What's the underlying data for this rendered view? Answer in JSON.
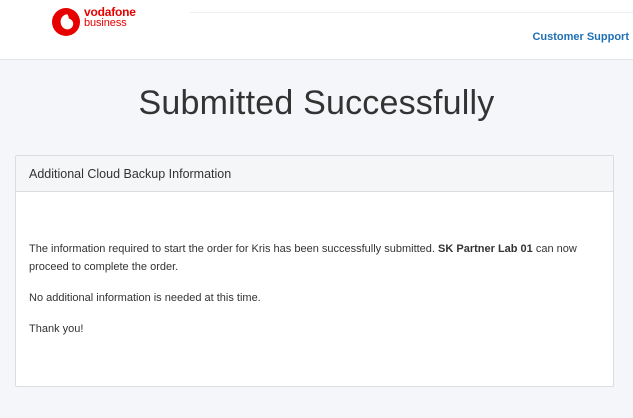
{
  "header": {
    "brand_line1": "vodafone",
    "brand_line2": "business",
    "brand_color": "#e60000",
    "support_link": "Customer Support",
    "link_color": "#1f6fb3"
  },
  "main": {
    "title": "Submitted Successfully",
    "card": {
      "title": "Additional Cloud Backup Information",
      "paragraph1_part1": "The information required to start the order for Kris has been successfully submitted. ",
      "paragraph1_bold": "SK Partner Lab 01",
      "paragraph1_part2": " can now proceed to complete the order.",
      "paragraph2": "No additional information is needed at this time.",
      "paragraph3": "Thank you!"
    }
  }
}
